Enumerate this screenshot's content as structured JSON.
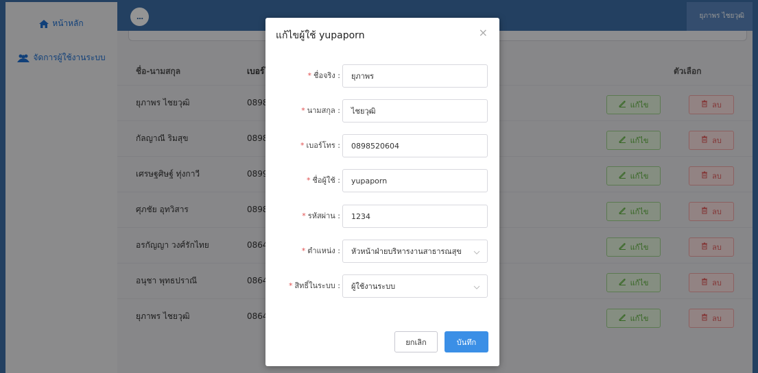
{
  "sidebar": {
    "home_label": "หน้าหลัก",
    "users_label": "จัดการผู้ใช้งานระบบ"
  },
  "header": {
    "menu_label": "...",
    "user_name": "ยุภาพร ไชยวุฒิ"
  },
  "table": {
    "headers": {
      "name": "ชื่อ-นามสกุล",
      "phone": "เบอร์โ",
      "options": "ตัวเลือก"
    },
    "rows": [
      {
        "name": "ยุภาพร ไชยวุฒิ",
        "phone": "0898"
      },
      {
        "name": "กัลญาณี ริมสุข",
        "phone": "0898"
      },
      {
        "name": "เศรษฐศิษฐ์ ทุ่งกาวี",
        "phone": "0899"
      },
      {
        "name": "ศุภชัย อุทวิสาร",
        "phone": "0898"
      },
      {
        "name": "อรกัญญา วงศ์รักไทย",
        "phone": "0864"
      },
      {
        "name": "อนุชา พุทธปราณี",
        "phone": "0864"
      },
      {
        "name": "ยุภาพร ไชยวุฒิ",
        "phone": "0864"
      }
    ],
    "edit_label": "แก้ไข",
    "delete_label": "ลบ"
  },
  "modal": {
    "title": "แก้ไขผู้ใช้ yupaporn",
    "close": "×",
    "fields": [
      {
        "label": "ชื่อจริง :",
        "value": "ยุภาพร"
      },
      {
        "label": "นามสกุล :",
        "value": "ไชยวุฒิ"
      },
      {
        "label": "เบอร์โทร :",
        "value": "0898520604"
      },
      {
        "label": "ชื่อผู้ใช้ :",
        "value": "yupaporn"
      },
      {
        "label": "รหัสผ่าน :",
        "value": "1234"
      },
      {
        "label": "ตำแหน่ง :",
        "value": "หัวหน้าฝ่ายบริหารงานสาธารณสุข"
      },
      {
        "label": "สิทธิ์ในระบบ :",
        "value": "ผู้ใช้งานระบบ"
      }
    ],
    "cancel_label": "ยกเลิก",
    "save_label": "บันทึก"
  },
  "colors": {
    "header": "#3d6fa8",
    "primary": "#3b8fe6",
    "edit": "#5fb23f",
    "delete": "#e25b5b",
    "required": "#e04d4d"
  },
  "icons": [
    "home-icon",
    "users-icon",
    "ellipsis-icon",
    "edit-icon",
    "trash-icon",
    "close-icon",
    "chevron-down-icon"
  ]
}
